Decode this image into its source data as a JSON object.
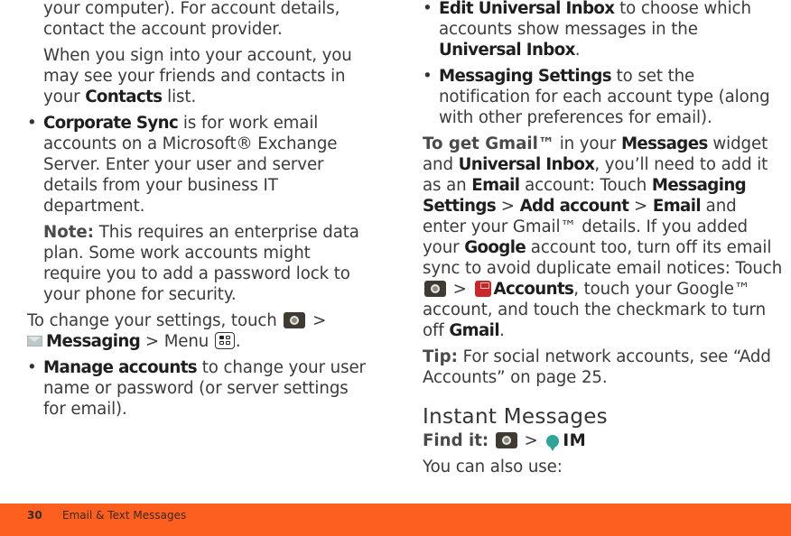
{
  "left_column": {
    "para1": "your computer). For account details, contact the account provider.",
    "para2_pre": "When you sign into your account, you may see your friends and contacts in your ",
    "para2_bold": "Contacts",
    "para2_post": " list.",
    "bullet_corporate": {
      "bold": "Corporate Sync",
      "text": " is for work email accounts on a Microsoft® Exchange Server. Enter your user and server details from your business IT department."
    },
    "note": {
      "label": "Note:",
      "text": " This requires an enterprise data plan. Some work accounts might require you to add a password lock to your phone for security."
    },
    "settings_line": {
      "pre": "To change your settings, touch ",
      "sep1": " >",
      "messaging": "Messaging",
      "sep2": " > Menu ",
      "end": "."
    },
    "bullet_manage": {
      "bold": "Manage accounts",
      "text": " to change your user name or password (or server settings for email)."
    }
  },
  "right_column": {
    "bullet_edit": {
      "bold": "Edit Universal Inbox",
      "text": " to choose which accounts show messages in the ",
      "bold2": "Universal Inbox",
      "end": "."
    },
    "bullet_msgsettings": {
      "bold": "Messaging Settings",
      "text": " to set the notification for each account type (along with other preferences for email)."
    },
    "gmail_para": {
      "label": "To get Gmail™",
      "t1": " in your ",
      "b1": "Messages",
      "t2": " widget and ",
      "b2": "Universal Inbox",
      "t3": ", you’ll need to add it as an ",
      "b3": "Email",
      "t4": " account: Touch ",
      "b4": "Messaging Settings",
      "t5": " > ",
      "b5": "Add account",
      "t6": " > ",
      "b6": "Email",
      "t7": " and enter your Gmail™ details. If you added your ",
      "b7": "Google",
      "t8": " account too, turn off its email sync to avoid duplicate email notices: Touch ",
      "t9": " > ",
      "b8": "Accounts",
      "t10": ", touch your Google™ account, and touch the checkmark to turn off ",
      "b9": "Gmail",
      "t11": "."
    },
    "tip": {
      "label": "Tip:",
      "text": " For social network accounts, see “Add Accounts” on page 25."
    },
    "heading": "Instant Messages",
    "find_it": {
      "label": "Find it:",
      "sep": " > ",
      "target": "IM"
    },
    "also_use": "You can also use:"
  },
  "footer": {
    "page_number": "30",
    "section_title": "Email & Text Messages",
    "color": "#fc5f1e"
  },
  "icons": {
    "home": "home-launcher-icon",
    "messaging": "envelope-icon",
    "menu": "menu-key-icon",
    "accounts": "accounts-icon",
    "im": "im-chat-bubble-icon"
  }
}
